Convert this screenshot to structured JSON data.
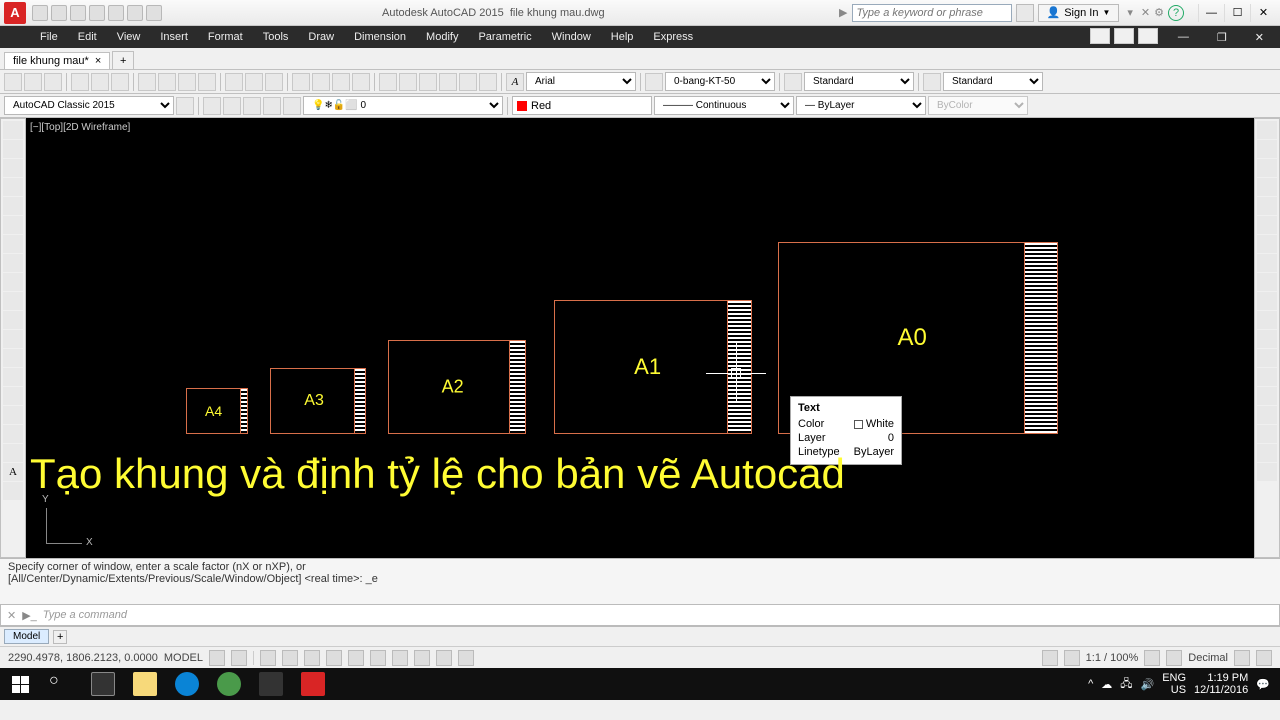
{
  "app": {
    "name": "Autodesk AutoCAD 2015",
    "file": "file khung mau.dwg",
    "search_placeholder": "Type a keyword or phrase",
    "signin": "Sign In"
  },
  "menu": [
    "File",
    "Edit",
    "View",
    "Insert",
    "Format",
    "Tools",
    "Draw",
    "Dimension",
    "Modify",
    "Parametric",
    "Window",
    "Help",
    "Express"
  ],
  "filetab": {
    "name": "file khung mau*",
    "close": "×",
    "add": "+"
  },
  "toolbar2": {
    "font": "Arial",
    "layer": "0-bang-KT-50",
    "style1": "Standard",
    "style2": "Standard"
  },
  "toolbar3": {
    "workspace": "AutoCAD Classic 2015",
    "layer0": "0",
    "color": "Red",
    "linetype": "Continuous",
    "lineweight": "ByLayer",
    "bycolor": "ByColor"
  },
  "viewport": "[−][Top][2D Wireframe]",
  "frames": {
    "a4": "A4",
    "a3": "A3",
    "a2": "A2",
    "a1": "A1",
    "a0": "A0"
  },
  "tooltip": {
    "title": "Text",
    "color_lbl": "Color",
    "color_val": "White",
    "layer_lbl": "Layer",
    "layer_val": "0",
    "ltype_lbl": "Linetype",
    "ltype_val": "ByLayer"
  },
  "overlay": "Tạo khung và định tỷ lệ cho bản vẽ Autocad",
  "ucs": {
    "x": "X",
    "y": "Y"
  },
  "cmd": {
    "line1": "Specify corner of window, enter a scale factor (nX or nXP), or",
    "line2": "[All/Center/Dynamic/Extents/Previous/Scale/Window/Object] <real time>: _e",
    "placeholder": "Type a command"
  },
  "modeltab": "Model",
  "status": {
    "coords": "2290.4978, 1806.2123, 0.0000",
    "mode": "MODEL",
    "scale": "1:1 / 100%",
    "annot": "Decimal"
  },
  "tray": {
    "lang": "ENG",
    "locale": "US",
    "time": "1:19 PM",
    "date": "12/11/2016"
  }
}
